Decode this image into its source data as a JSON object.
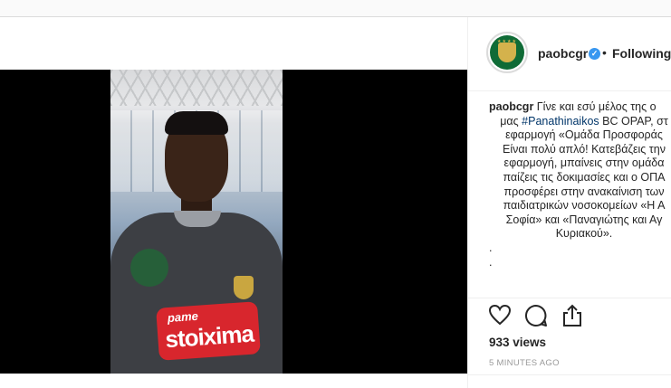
{
  "post": {
    "username": "paobcgr",
    "verified_icon": "verified-badge-icon",
    "separator": "•",
    "follow_status": "Following",
    "caption_user": "paobcgr",
    "caption_lines": [
      "Γίνε και εσύ μέλος της ο",
      "μας #Panathinaikos BC OPAP, στ",
      "εφαρμογή «Ομάδα Προσφοράς",
      "Είναι πολύ απλό! Κατεβάζεις την",
      "εφαρμογή, μπαίνεις στην ομάδα",
      "παίζεις τις δοκιμασίες και ο ΟΠΑ",
      "προσφέρει στην ανακαίνιση των",
      "παιδιατρικών νοσοκομείων «Η Α",
      "Σοφία» και «Παναγιώτης και Αγ",
      "Κυριακού».",
      ".",
      "."
    ],
    "hashtag": "#Panathinaikos",
    "views": "933 views",
    "timestamp": "5 MINUTES AGO"
  },
  "media": {
    "sponsor_line1": "pame",
    "sponsor_line2": "stoixima"
  },
  "actions": [
    "heart-icon",
    "comment-icon",
    "share-icon"
  ]
}
